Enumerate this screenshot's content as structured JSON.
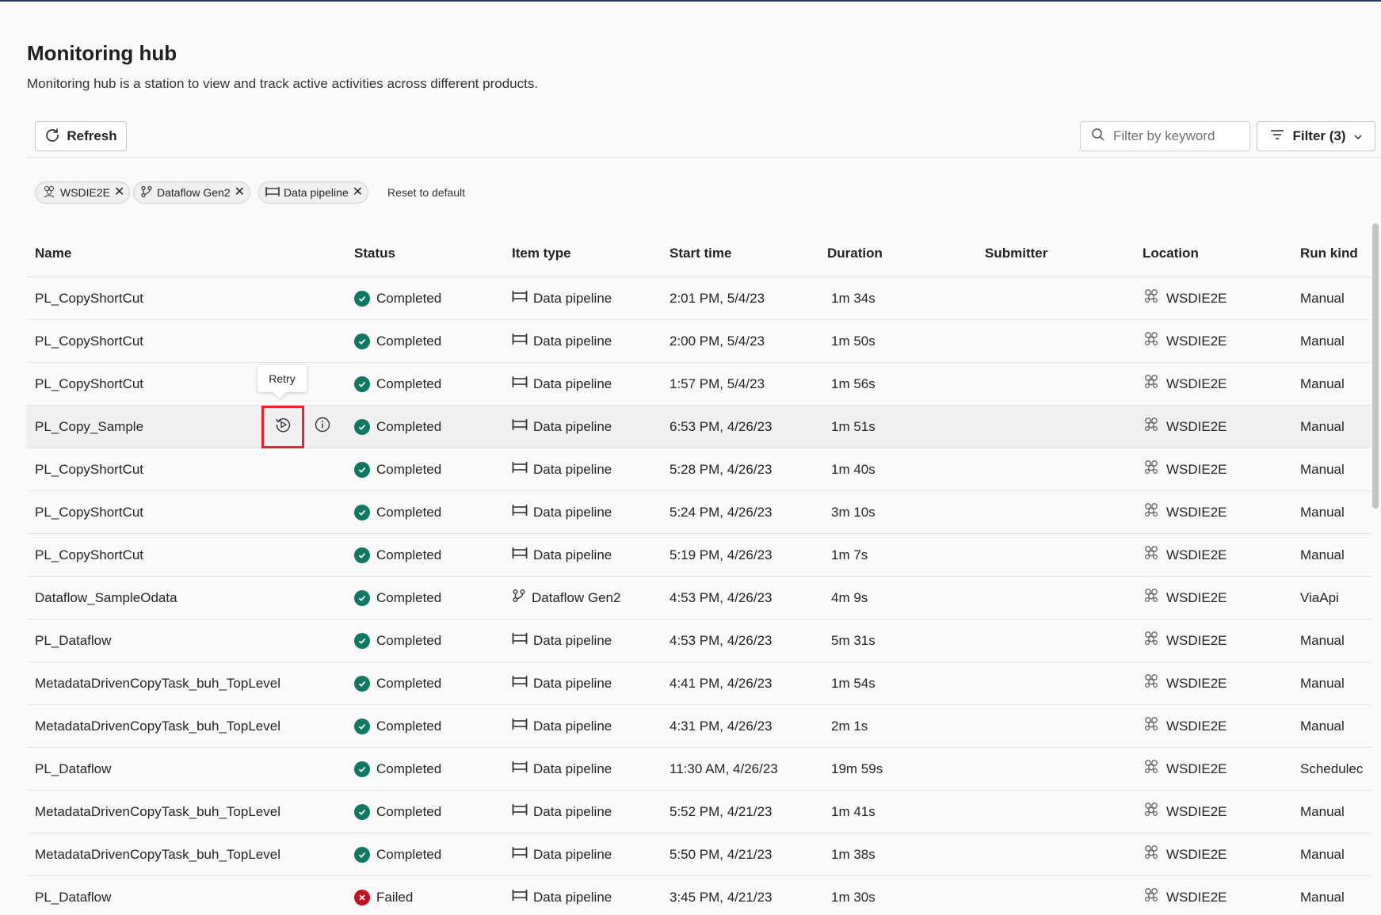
{
  "header": {
    "title": "Monitoring hub",
    "subtitle": "Monitoring hub is a station to view and track active activities across different products."
  },
  "toolbar": {
    "refresh_label": "Refresh",
    "search_placeholder": "Filter by keyword",
    "filter_label": "Filter (3)"
  },
  "chips": [
    {
      "label": "WSDIE2E",
      "icon": "workspace-icon"
    },
    {
      "label": "Dataflow Gen2",
      "icon": "dataflow-icon"
    },
    {
      "label": "Data pipeline",
      "icon": "pipeline-icon"
    }
  ],
  "reset_label": "Reset to default",
  "columns": {
    "name": "Name",
    "status": "Status",
    "item_type": "Item type",
    "start_time": "Start time",
    "duration": "Duration",
    "submitter": "Submitter",
    "location": "Location",
    "run_kind": "Run kind"
  },
  "tooltip": "Retry",
  "rows": [
    {
      "name": "PL_CopyShortCut",
      "status": "Completed",
      "type": "Data pipeline",
      "start": "2:01 PM, 5/4/23",
      "duration": "1m 34s",
      "submitter": "",
      "location": "WSDIE2E",
      "kind": "Manual"
    },
    {
      "name": "PL_CopyShortCut",
      "status": "Completed",
      "type": "Data pipeline",
      "start": "2:00 PM, 5/4/23",
      "duration": "1m 50s",
      "submitter": "",
      "location": "WSDIE2E",
      "kind": "Manual"
    },
    {
      "name": "PL_CopyShortCut",
      "status": "Completed",
      "type": "Data pipeline",
      "start": "1:57 PM, 5/4/23",
      "duration": "1m 56s",
      "submitter": "",
      "location": "WSDIE2E",
      "kind": "Manual"
    },
    {
      "name": "PL_Copy_Sample",
      "status": "Completed",
      "type": "Data pipeline",
      "start": "6:53 PM, 4/26/23",
      "duration": "1m 51s",
      "submitter": "",
      "location": "WSDIE2E",
      "kind": "Manual"
    },
    {
      "name": "PL_CopyShortCut",
      "status": "Completed",
      "type": "Data pipeline",
      "start": "5:28 PM, 4/26/23",
      "duration": "1m 40s",
      "submitter": "",
      "location": "WSDIE2E",
      "kind": "Manual"
    },
    {
      "name": "PL_CopyShortCut",
      "status": "Completed",
      "type": "Data pipeline",
      "start": "5:24 PM, 4/26/23",
      "duration": "3m 10s",
      "submitter": "",
      "location": "WSDIE2E",
      "kind": "Manual"
    },
    {
      "name": "PL_CopyShortCut",
      "status": "Completed",
      "type": "Data pipeline",
      "start": "5:19 PM, 4/26/23",
      "duration": "1m 7s",
      "submitter": "",
      "location": "WSDIE2E",
      "kind": "Manual"
    },
    {
      "name": "Dataflow_SampleOdata",
      "status": "Completed",
      "type": "Dataflow Gen2",
      "start": "4:53 PM, 4/26/23",
      "duration": "4m 9s",
      "submitter": "",
      "location": "WSDIE2E",
      "kind": "ViaApi"
    },
    {
      "name": "PL_Dataflow",
      "status": "Completed",
      "type": "Data pipeline",
      "start": "4:53 PM, 4/26/23",
      "duration": "5m 31s",
      "submitter": "",
      "location": "WSDIE2E",
      "kind": "Manual"
    },
    {
      "name": "MetadataDrivenCopyTask_buh_TopLevel",
      "status": "Completed",
      "type": "Data pipeline",
      "start": "4:41 PM, 4/26/23",
      "duration": "1m 54s",
      "submitter": "",
      "location": "WSDIE2E",
      "kind": "Manual"
    },
    {
      "name": "MetadataDrivenCopyTask_buh_TopLevel",
      "status": "Completed",
      "type": "Data pipeline",
      "start": "4:31 PM, 4/26/23",
      "duration": "2m 1s",
      "submitter": "",
      "location": "WSDIE2E",
      "kind": "Manual"
    },
    {
      "name": "PL_Dataflow",
      "status": "Completed",
      "type": "Data pipeline",
      "start": "11:30 AM, 4/26/23",
      "duration": "19m 59s",
      "submitter": "",
      "location": "WSDIE2E",
      "kind": "Schedulec"
    },
    {
      "name": "MetadataDrivenCopyTask_buh_TopLevel",
      "status": "Completed",
      "type": "Data pipeline",
      "start": "5:52 PM, 4/21/23",
      "duration": "1m 41s",
      "submitter": "",
      "location": "WSDIE2E",
      "kind": "Manual"
    },
    {
      "name": "MetadataDrivenCopyTask_buh_TopLevel",
      "status": "Completed",
      "type": "Data pipeline",
      "start": "5:50 PM, 4/21/23",
      "duration": "1m 38s",
      "submitter": "",
      "location": "WSDIE2E",
      "kind": "Manual"
    },
    {
      "name": "PL_Dataflow",
      "status": "Failed",
      "type": "Data pipeline",
      "start": "3:45 PM, 4/21/23",
      "duration": "1m 30s",
      "submitter": "",
      "location": "WSDIE2E",
      "kind": "Manual"
    }
  ],
  "hovered_row": 3,
  "colors": {
    "completed": "#117865",
    "failed": "#c50f1f",
    "retry_highlight": "#e3242b",
    "top_rule": "#243a5e"
  }
}
